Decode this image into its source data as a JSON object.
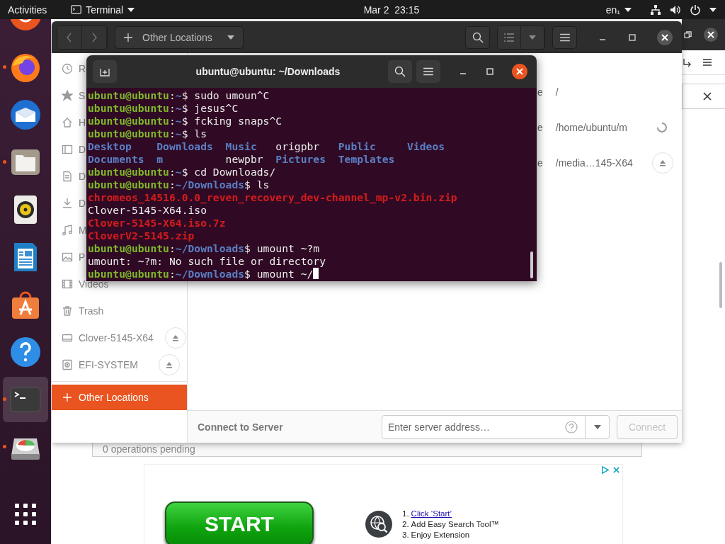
{
  "top_bar": {
    "activities": "Activities",
    "app_menu": "Terminal",
    "clock": "Mar 2  23:15",
    "input_source": "en₁"
  },
  "dock": {
    "items": [
      {
        "kind": "ubuntu",
        "running": false,
        "selected": false
      },
      {
        "kind": "firefox",
        "running": true,
        "selected": false
      },
      {
        "kind": "mail",
        "running": false,
        "selected": false
      },
      {
        "kind": "files",
        "running": true,
        "selected": false
      },
      {
        "kind": "speaker",
        "running": false,
        "selected": false
      },
      {
        "kind": "writer",
        "running": false,
        "selected": false
      },
      {
        "kind": "software",
        "running": false,
        "selected": false
      },
      {
        "kind": "help",
        "running": false,
        "selected": false
      },
      {
        "kind": "terminal",
        "running": true,
        "selected": true
      },
      {
        "kind": "disk",
        "running": true,
        "selected": false
      }
    ]
  },
  "files_window": {
    "location": "Other Locations",
    "sidebar": {
      "items": [
        {
          "label": "R",
          "kind": "clock",
          "eject": false,
          "selected": false
        },
        {
          "label": "S",
          "kind": "star",
          "eject": false,
          "selected": false
        },
        {
          "label": "H",
          "kind": "home",
          "eject": false,
          "selected": false
        },
        {
          "label": "D",
          "kind": "desktop",
          "eject": false,
          "selected": false
        },
        {
          "label": "D",
          "kind": "document",
          "eject": false,
          "selected": false
        },
        {
          "label": "D",
          "kind": "download",
          "eject": false,
          "selected": false
        },
        {
          "label": "M",
          "kind": "music",
          "eject": false,
          "selected": false
        },
        {
          "label": "P",
          "kind": "picture",
          "eject": false,
          "selected": false
        },
        {
          "label": "Videos",
          "kind": "film",
          "eject": false,
          "selected": false
        },
        {
          "label": "Trash",
          "kind": "trash",
          "eject": false,
          "selected": false
        },
        {
          "label": "Clover-5145-X64",
          "kind": "drive",
          "eject": true,
          "selected": false
        },
        {
          "label": "EFI-SYSTEM",
          "kind": "disc",
          "eject": true,
          "selected": false
        },
        {
          "label": "Other Locations",
          "kind": "plus",
          "eject": false,
          "selected": true
        }
      ]
    },
    "rows": [
      {
        "column_1": "e",
        "path": "/",
        "kind": "none"
      },
      {
        "column_1": "e",
        "path": "/home/ubuntu/m",
        "kind": "spinner"
      },
      {
        "column_1": "e",
        "path": "/media…145-X64",
        "kind": "eject"
      }
    ],
    "connect_bar": {
      "label": "Connect to Server",
      "placeholder": "Enter server address…",
      "button": {
        "label": "Connect",
        "disabled": true
      }
    }
  },
  "terminal": {
    "title": "ubuntu@ubuntu: ~/Downloads",
    "lines": [
      {
        "segments": [
          {
            "text": "ubuntu@ubuntu",
            "kind": "user"
          },
          {
            "text": ":",
            "kind": "plain"
          },
          {
            "text": "~",
            "kind": "path"
          },
          {
            "text": "$ sudo umoun^C",
            "kind": "plain"
          }
        ]
      },
      {
        "segments": [
          {
            "text": "ubuntu@ubuntu",
            "kind": "user"
          },
          {
            "text": ":",
            "kind": "plain"
          },
          {
            "text": "~",
            "kind": "path"
          },
          {
            "text": "$ jesus^C",
            "kind": "plain"
          }
        ]
      },
      {
        "segments": [
          {
            "text": "ubuntu@ubuntu",
            "kind": "user"
          },
          {
            "text": ":",
            "kind": "plain"
          },
          {
            "text": "~",
            "kind": "path"
          },
          {
            "text": "$ fcking snaps^C",
            "kind": "plain"
          }
        ]
      },
      {
        "segments": [
          {
            "text": "ubuntu@ubuntu",
            "kind": "user"
          },
          {
            "text": ":",
            "kind": "plain"
          },
          {
            "text": "~",
            "kind": "path"
          },
          {
            "text": "$ ls",
            "kind": "plain"
          }
        ]
      },
      {
        "segments": [
          {
            "text": "Desktop    ",
            "kind": "dir"
          },
          {
            "text": "Downloads  ",
            "kind": "dir"
          },
          {
            "text": "Music   ",
            "kind": "dir"
          },
          {
            "text": "origpbr   ",
            "kind": "plain"
          },
          {
            "text": "Public     ",
            "kind": "dir"
          },
          {
            "text": "Videos",
            "kind": "dir"
          }
        ]
      },
      {
        "segments": [
          {
            "text": "Documents  ",
            "kind": "dir"
          },
          {
            "text": "m          ",
            "kind": "dir"
          },
          {
            "text": "newpbr  ",
            "kind": "plain"
          },
          {
            "text": "Pictures  ",
            "kind": "dir"
          },
          {
            "text": "Templates",
            "kind": "dir"
          }
        ]
      },
      {
        "segments": [
          {
            "text": "ubuntu@ubuntu",
            "kind": "user"
          },
          {
            "text": ":",
            "kind": "plain"
          },
          {
            "text": "~",
            "kind": "path"
          },
          {
            "text": "$ cd Downloads/",
            "kind": "plain"
          }
        ]
      },
      {
        "segments": [
          {
            "text": "ubuntu@ubuntu",
            "kind": "user"
          },
          {
            "text": ":",
            "kind": "plain"
          },
          {
            "text": "~/Downloads",
            "kind": "path"
          },
          {
            "text": "$ ls",
            "kind": "plain"
          }
        ]
      },
      {
        "segments": [
          {
            "text": "chromeos_14516.0.0_reven_recovery_dev-channel_mp-v2.bin.zip",
            "kind": "archive"
          }
        ]
      },
      {
        "segments": [
          {
            "text": "Clover-5145-X64.iso",
            "kind": "plain"
          }
        ]
      },
      {
        "segments": [
          {
            "text": "Clover-5145-X64.iso.7z",
            "kind": "archive"
          }
        ]
      },
      {
        "segments": [
          {
            "text": "CloverV2-5145.zip",
            "kind": "archive"
          }
        ]
      },
      {
        "segments": [
          {
            "text": "ubuntu@ubuntu",
            "kind": "user"
          },
          {
            "text": ":",
            "kind": "plain"
          },
          {
            "text": "~/Downloads",
            "kind": "path"
          },
          {
            "text": "$ umount ~?m",
            "kind": "plain"
          }
        ]
      },
      {
        "segments": [
          {
            "text": "umount: ~?m: No such file or directory",
            "kind": "plain"
          }
        ]
      },
      {
        "segments": [
          {
            "text": "ubuntu@ubuntu",
            "kind": "user"
          },
          {
            "text": ":",
            "kind": "plain"
          },
          {
            "text": "~/Downloads",
            "kind": "path"
          },
          {
            "text": "$ umount ~/",
            "kind": "plain"
          }
        ]
      }
    ]
  },
  "operations_bar": "0 operations pending",
  "ad": {
    "start": "START",
    "steps": [
      {
        "number": "1.",
        "text": "Click ‘Start’",
        "link": true
      },
      {
        "number": "2.",
        "text": "Add Easy Search Tool™",
        "link": false
      },
      {
        "number": "3.",
        "text": "Enjoy Extension",
        "link": false
      }
    ]
  }
}
